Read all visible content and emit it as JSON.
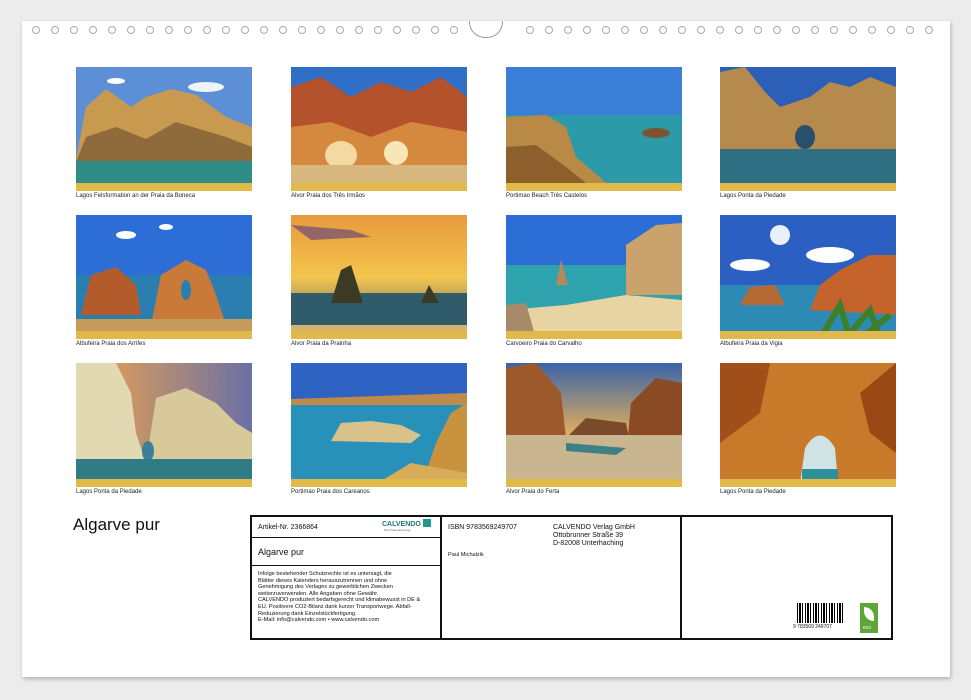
{
  "calendar_title": "Algarve pur",
  "photos": [
    {
      "caption": "Lagos Felsformation an der Praia da Boneca"
    },
    {
      "caption": "Alvor Praia dos Três Irmãos"
    },
    {
      "caption": "Portimao Beach Três Castelos"
    },
    {
      "caption": "Lagos Ponta da Piedade"
    },
    {
      "caption": "Albufeira Praia dos Arrifes"
    },
    {
      "caption": "Alvor Praia da Prainha"
    },
    {
      "caption": "Carvoeiro Praia do Carvalho"
    },
    {
      "caption": "Albufeira Praia da Vigia"
    },
    {
      "caption": "Lagos Ponta da Piedade"
    },
    {
      "caption": "Portimao Praia dos Careanos"
    },
    {
      "caption": "Alvor Praia do Ferta"
    },
    {
      "caption": "Lagos Ponta da Piedade"
    }
  ],
  "info": {
    "article_no": "Artikel-Nr. 2366864",
    "brand": "CALVENDO",
    "brand_tagline": "Das Kalenderverlag",
    "title": "Algarve pur",
    "legal": [
      "Infolge bestehender Schutzrechte ist es untersagt, die",
      "Blätter dieses Kalenders herauszutrennen und ohne",
      "Genehmigung des Verlages zu gewerblichen Zwecken",
      "weiterzuverwenden. Alle Angaben ohne Gewähr.",
      "CALVENDO produziert bedarfsgerecht und klimabewusst in DE &",
      "EU. Positivere CO2-Bilanz dank kurzer Transportwege. Abfall-",
      "Reduzierung dank Einzelstückfertigung.",
      "E-Mail: info@calvendo.com • www.calvendo.com"
    ],
    "isbn": "ISBN 9783569249707",
    "author": "Paul Michalzik",
    "publisher_lines": [
      "CALVENDO Verlag GmbH",
      "Ottobrunner Straße 39",
      "D-82008 Unterhaching"
    ],
    "barcode_number": "9 783569 249707",
    "eco_label": "eco"
  }
}
